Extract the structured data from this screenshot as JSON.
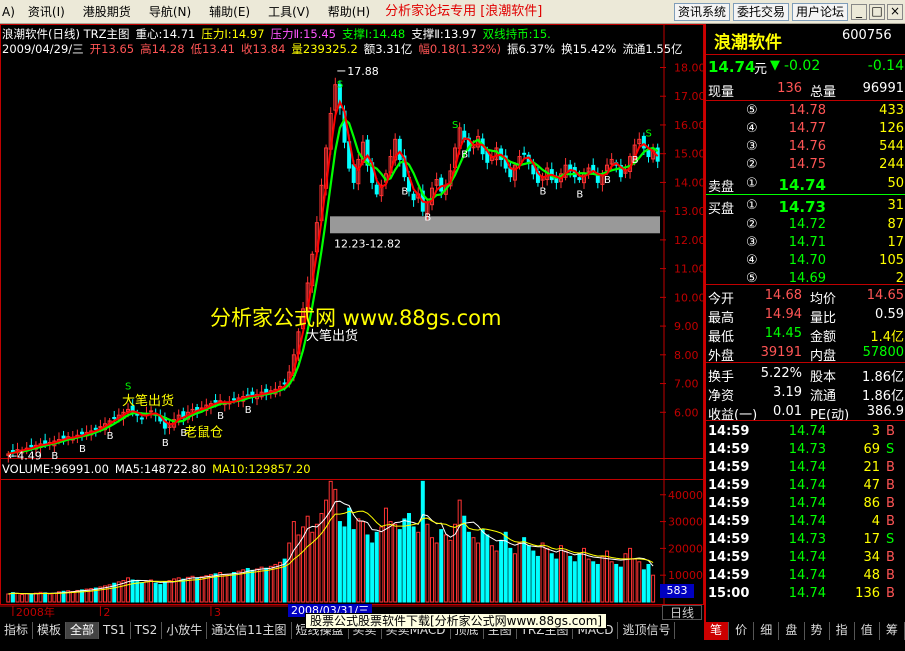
{
  "menu": {
    "items": [
      "资讯(I)",
      "港股期货",
      "导航(N)",
      "辅助(E)",
      "工具(V)",
      "帮助(H)"
    ],
    "left_stub": "A)",
    "center_title": "分析家论坛专用 [浪潮软件]",
    "buttons": [
      "资讯系统",
      "委托交易",
      "用户论坛"
    ],
    "win_controls": [
      "_",
      "□",
      "×"
    ]
  },
  "info": {
    "line1": [
      {
        "text": "浪潮软件(日线) TRZ主图",
        "color": "#ffffff"
      },
      {
        "text": "重心:14.71",
        "color": "#ffffff"
      },
      {
        "text": "压力Ⅰ:14.97",
        "color": "#ffff00"
      },
      {
        "text": "压力Ⅱ:15.45",
        "color": "#ff55ff"
      },
      {
        "text": "支撑Ⅰ:14.48",
        "color": "#00ff00"
      },
      {
        "text": "支撑Ⅱ:13.97",
        "color": "#ffffff"
      },
      {
        "text": "双线持币:15.",
        "color": "#00ff00"
      }
    ],
    "line2": [
      {
        "text": "2009/04/29/三",
        "color": "#ffffff"
      },
      {
        "text": "开13.65",
        "color": "#ff5555"
      },
      {
        "text": "高14.28",
        "color": "#ff5555"
      },
      {
        "text": "低13.41",
        "color": "#ff5555"
      },
      {
        "text": "收13.84",
        "color": "#ff5555"
      },
      {
        "text": "量239325.2",
        "color": "#ffff00"
      },
      {
        "text": "额3.31亿",
        "color": "#ffffff"
      },
      {
        "text": "幅0.18(1.32%)",
        "color": "#ff5555"
      },
      {
        "text": "振6.37%",
        "color": "#ffffff"
      },
      {
        "text": "换15.42%",
        "color": "#ffffff"
      },
      {
        "text": "流通1.55亿",
        "color": "#ffffff"
      }
    ],
    "vol_line": [
      {
        "text": "VOLUME:96991.00",
        "color": "#ffffff"
      },
      {
        "text": "MA5:148722.80",
        "color": "#ffffff"
      },
      {
        "text": "MA10:129857.20",
        "color": "#ffff00"
      }
    ]
  },
  "chart_data": {
    "type": "candlestick",
    "y_ticks": [
      6.0,
      7.0,
      8.0,
      9.0,
      10.0,
      11.0,
      12.0,
      13.0,
      14.0,
      15.0,
      16.0,
      17.0,
      18.0
    ],
    "y_tick_labels": [
      "6.00",
      "7.00",
      "8.00",
      "9.00",
      "10.00",
      "11.00",
      "12.00",
      "13.00",
      "14.00",
      "15.00",
      "16.00",
      "17.00",
      "18.00"
    ],
    "ylim": [
      4.2,
      18.4
    ],
    "vol_ticks": [
      10000,
      20000,
      30000,
      40000
    ],
    "vol_tick_labels": [
      "10000",
      "20000",
      "30000",
      "40000"
    ],
    "vol_max": 47000,
    "x_labels": [
      {
        "text": "2008年",
        "index": 1
      },
      {
        "text": "2",
        "index": 20
      },
      {
        "text": "3",
        "index": 44
      }
    ],
    "annotations": {
      "high_label": "17.88",
      "low_label": "4.49",
      "zone_label": "12.23-12.82",
      "zone": [
        12.23,
        12.82
      ],
      "chu_huo_1": "大笔出货",
      "chu_huo_2": "大笔出货",
      "lao_shu_cang": "老鼠仓"
    },
    "closes": [
      4.55,
      4.62,
      4.7,
      4.68,
      4.75,
      4.8,
      4.85,
      4.9,
      4.88,
      4.95,
      5.0,
      5.05,
      5.1,
      5.15,
      5.1,
      5.2,
      5.25,
      5.3,
      5.35,
      5.4,
      5.5,
      5.6,
      5.7,
      5.8,
      5.9,
      6.0,
      6.1,
      6.0,
      5.9,
      5.8,
      5.95,
      6.05,
      5.9,
      5.7,
      5.45,
      5.6,
      5.75,
      5.9,
      5.8,
      6.0,
      6.1,
      6.05,
      6.15,
      6.25,
      6.3,
      6.35,
      6.4,
      6.3,
      6.35,
      6.45,
      6.5,
      6.55,
      6.6,
      6.55,
      6.62,
      6.7,
      6.65,
      6.75,
      6.8,
      6.9,
      7.0,
      7.4,
      8.0,
      8.8,
      9.6,
      10.5,
      11.5,
      12.6,
      13.9,
      15.2,
      16.4,
      17.4,
      16.6,
      15.4,
      14.5,
      14.0,
      14.8,
      15.4,
      14.6,
      14.0,
      13.6,
      13.9,
      14.3,
      14.9,
      15.5,
      14.8,
      14.2,
      13.7,
      13.4,
      13.6,
      13.0,
      13.3,
      13.8,
      14.1,
      13.7,
      13.9,
      14.4,
      15.2,
      15.9,
      15.5,
      15.1,
      15.3,
      15.6,
      15.0,
      14.7,
      14.9,
      15.2,
      14.8,
      14.5,
      14.2,
      14.6,
      14.9,
      15.0,
      14.7,
      14.3,
      14.0,
      14.2,
      14.5,
      14.1,
      14.0,
      14.3,
      14.6,
      14.4,
      14.2,
      14.1,
      14.3,
      14.5,
      14.4,
      14.0,
      14.3,
      14.6,
      14.8,
      14.6,
      14.2,
      14.4,
      14.9,
      15.3,
      15.5,
      15.2,
      14.9,
      15.1,
      14.74
    ],
    "volumes": [
      3000,
      3500,
      3200,
      2800,
      3100,
      2900,
      3300,
      3600,
      3400,
      3000,
      3200,
      3800,
      4000,
      4200,
      3900,
      4300,
      4500,
      4800,
      5000,
      5200,
      5600,
      6000,
      6400,
      7000,
      7500,
      8000,
      9000,
      8200,
      7600,
      7200,
      7800,
      8200,
      7000,
      6500,
      7500,
      8000,
      8600,
      9000,
      8500,
      9200,
      9600,
      9000,
      9400,
      9800,
      10200,
      10500,
      11000,
      10000,
      10400,
      11000,
      11500,
      12000,
      12500,
      11800,
      12300,
      13000,
      12600,
      13300,
      14000,
      14800,
      16000,
      22000,
      30000,
      25000,
      28000,
      32000,
      26000,
      29000,
      33000,
      38000,
      45000,
      42000,
      30000,
      28000,
      35000,
      27000,
      31000,
      30000,
      25000,
      22000,
      26000,
      28000,
      35000,
      30000,
      29000,
      27000,
      31000,
      33000,
      28000,
      26000,
      45000,
      29000,
      24000,
      22000,
      27000,
      25000,
      23000,
      29000,
      38000,
      32000,
      26000,
      24000,
      22000,
      27000,
      25000,
      21000,
      19000,
      23000,
      26000,
      20000,
      18000,
      22000,
      24000,
      21000,
      19000,
      17000,
      22000,
      20000,
      18000,
      16000,
      21000,
      19000,
      17000,
      15000,
      18000,
      20000,
      16000,
      15000,
      14000,
      17000,
      19000,
      15000,
      14000,
      13000,
      18000,
      20000,
      16000,
      15000,
      12000,
      14000,
      10000
    ]
  },
  "overlays": {
    "watermark": "分析家公式网 www.88gs.com",
    "tooltip": "股票公式股票软件下载[分析家公式网www.88gs.com]",
    "date_box": "2008/03/31/三",
    "value_box": "583",
    "period": "日线"
  },
  "quote": {
    "name": "浪潮软件",
    "code": "600756",
    "price": "14.74",
    "price_unit": "元",
    "change": "-0.02",
    "change_pct": "-0.14",
    "xianliang_label": "现量",
    "xianliang": "136",
    "zongliang_label": "总量",
    "zongliang": "96991",
    "asks": [
      {
        "lvl": "⑤",
        "price": "14.78",
        "vol": "433"
      },
      {
        "lvl": "④",
        "price": "14.77",
        "vol": "126"
      },
      {
        "lvl": "③",
        "price": "14.76",
        "vol": "544"
      },
      {
        "lvl": "②",
        "price": "14.75",
        "vol": "244"
      }
    ],
    "ask1": {
      "label": "卖盘",
      "lvl": "①",
      "price": "14.74",
      "vol": "50"
    },
    "bid1": {
      "label": "买盘",
      "lvl": "①",
      "price": "14.73",
      "vol": "31"
    },
    "bids": [
      {
        "lvl": "②",
        "price": "14.72",
        "vol": "87"
      },
      {
        "lvl": "③",
        "price": "14.71",
        "vol": "17"
      },
      {
        "lvl": "④",
        "price": "14.70",
        "vol": "105"
      },
      {
        "lvl": "⑤",
        "price": "14.69",
        "vol": "2"
      }
    ],
    "stats": [
      {
        "l1": "今开",
        "v1": "14.68",
        "c1": "#ff5555",
        "l2": "均价",
        "v2": "14.65",
        "c2": "#ff5555"
      },
      {
        "l1": "最高",
        "v1": "14.94",
        "c1": "#ff5555",
        "l2": "量比",
        "v2": "0.59",
        "c2": "#ffffff"
      },
      {
        "l1": "最低",
        "v1": "14.45",
        "c1": "#00ff00",
        "l2": "金额",
        "v2": "1.4亿",
        "c2": "#ffff00"
      },
      {
        "l1": "外盘",
        "v1": "39191",
        "c1": "#ff5555",
        "l2": "内盘",
        "v2": "57800",
        "c2": "#00ff00"
      }
    ],
    "stats2": [
      {
        "l1": "换手",
        "v1": "5.22%",
        "l2": "股本",
        "v2": "1.86亿"
      },
      {
        "l1": "净资",
        "v1": "3.19",
        "l2": "流通",
        "v2": "1.86亿"
      },
      {
        "l1": "收益(一)",
        "v1": "0.01",
        "l2": "PE(动)",
        "v2": "386.9"
      }
    ],
    "ticks": [
      {
        "time": "14:59",
        "price": "14.74",
        "vol": "3",
        "side": "B"
      },
      {
        "time": "14:59",
        "price": "14.73",
        "vol": "69",
        "side": "S"
      },
      {
        "time": "14:59",
        "price": "14.74",
        "vol": "21",
        "side": "B"
      },
      {
        "time": "14:59",
        "price": "14.74",
        "vol": "47",
        "side": "B"
      },
      {
        "time": "14:59",
        "price": "14.74",
        "vol": "86",
        "side": "B"
      },
      {
        "time": "14:59",
        "price": "14.74",
        "vol": "4",
        "side": "B"
      },
      {
        "time": "14:59",
        "price": "14.73",
        "vol": "17",
        "side": "S"
      },
      {
        "time": "14:59",
        "price": "14.74",
        "vol": "34",
        "side": "B"
      },
      {
        "time": "14:59",
        "price": "14.74",
        "vol": "48",
        "side": "B"
      },
      {
        "time": "15:00",
        "price": "14.74",
        "vol": "136",
        "side": "B"
      }
    ]
  },
  "tabs": [
    "指标",
    "模板",
    "全部",
    "TS1",
    "TS2",
    "小放牛",
    "通达信11主图",
    "短线操盘",
    "买卖",
    "买卖MACD",
    "顶底",
    "主图",
    "TRZ主图",
    "MACD",
    "逃顶信号"
  ],
  "active_tab": 2,
  "rtabs": [
    "笔",
    "价",
    "细",
    "盘",
    "势",
    "指",
    "值",
    "筹"
  ],
  "colors": {
    "up": "#ff3333",
    "down": "#00ffff",
    "ma_green": "#00ff00",
    "ma_red": "#ff0000"
  }
}
